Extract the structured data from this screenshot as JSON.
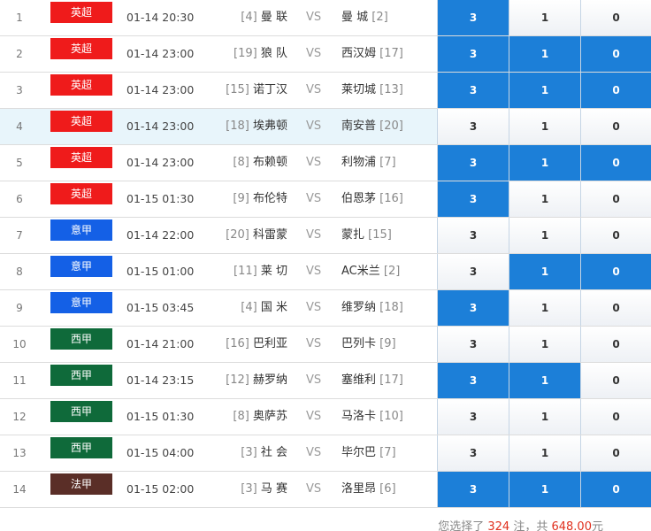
{
  "colors": {
    "league_epl": "#ef1b1b",
    "league_seriea": "#1460e6",
    "league_laliga": "#0f6a3a",
    "league_ligue1": "#5a2e27",
    "selected_odds": "#1c7fd8"
  },
  "vs_label": "VS",
  "rows": [
    {
      "idx": "1",
      "league": "英超",
      "league_color": "#ef1b1b",
      "time": "01-14 20:30",
      "home_rank": "[4]",
      "home": "曼 联",
      "away": "曼 城",
      "away_rank": "[2]",
      "odds": [
        "3",
        "1",
        "0"
      ],
      "selected": [
        true,
        false,
        false
      ],
      "highlight": false
    },
    {
      "idx": "2",
      "league": "英超",
      "league_color": "#ef1b1b",
      "time": "01-14 23:00",
      "home_rank": "[19]",
      "home": "狼 队",
      "away": "西汉姆",
      "away_rank": "[17]",
      "odds": [
        "3",
        "1",
        "0"
      ],
      "selected": [
        true,
        true,
        true
      ],
      "highlight": false
    },
    {
      "idx": "3",
      "league": "英超",
      "league_color": "#ef1b1b",
      "time": "01-14 23:00",
      "home_rank": "[15]",
      "home": "诺丁汉",
      "away": "莱切城",
      "away_rank": "[13]",
      "odds": [
        "3",
        "1",
        "0"
      ],
      "selected": [
        true,
        true,
        true
      ],
      "highlight": false
    },
    {
      "idx": "4",
      "league": "英超",
      "league_color": "#ef1b1b",
      "time": "01-14 23:00",
      "home_rank": "[18]",
      "home": "埃弗顿",
      "away": "南安普",
      "away_rank": "[20]",
      "odds": [
        "3",
        "1",
        "0"
      ],
      "selected": [
        false,
        false,
        false
      ],
      "highlight": true
    },
    {
      "idx": "5",
      "league": "英超",
      "league_color": "#ef1b1b",
      "time": "01-14 23:00",
      "home_rank": "[8]",
      "home": "布赖顿",
      "away": "利物浦",
      "away_rank": "[7]",
      "odds": [
        "3",
        "1",
        "0"
      ],
      "selected": [
        true,
        true,
        true
      ],
      "highlight": false
    },
    {
      "idx": "6",
      "league": "英超",
      "league_color": "#ef1b1b",
      "time": "01-15 01:30",
      "home_rank": "[9]",
      "home": "布伦特",
      "away": "伯恩茅",
      "away_rank": "[16]",
      "odds": [
        "3",
        "1",
        "0"
      ],
      "selected": [
        true,
        false,
        false
      ],
      "highlight": false
    },
    {
      "idx": "7",
      "league": "意甲",
      "league_color": "#1460e6",
      "time": "01-14 22:00",
      "home_rank": "[20]",
      "home": "科雷蒙",
      "away": "蒙扎",
      "away_rank": "[15]",
      "odds": [
        "3",
        "1",
        "0"
      ],
      "selected": [
        false,
        false,
        false
      ],
      "highlight": false
    },
    {
      "idx": "8",
      "league": "意甲",
      "league_color": "#1460e6",
      "time": "01-15 01:00",
      "home_rank": "[11]",
      "home": "莱 切",
      "away": "AC米兰",
      "away_rank": "[2]",
      "odds": [
        "3",
        "1",
        "0"
      ],
      "selected": [
        false,
        true,
        true
      ],
      "highlight": false
    },
    {
      "idx": "9",
      "league": "意甲",
      "league_color": "#1460e6",
      "time": "01-15 03:45",
      "home_rank": "[4]",
      "home": "国 米",
      "away": "维罗纳",
      "away_rank": "[18]",
      "odds": [
        "3",
        "1",
        "0"
      ],
      "selected": [
        true,
        false,
        false
      ],
      "highlight": false
    },
    {
      "idx": "10",
      "league": "西甲",
      "league_color": "#0f6a3a",
      "time": "01-14 21:00",
      "home_rank": "[16]",
      "home": "巴利亚",
      "away": "巴列卡",
      "away_rank": "[9]",
      "odds": [
        "3",
        "1",
        "0"
      ],
      "selected": [
        false,
        false,
        false
      ],
      "highlight": false
    },
    {
      "idx": "11",
      "league": "西甲",
      "league_color": "#0f6a3a",
      "time": "01-14 23:15",
      "home_rank": "[12]",
      "home": "赫罗纳",
      "away": "塞维利",
      "away_rank": "[17]",
      "odds": [
        "3",
        "1",
        "0"
      ],
      "selected": [
        true,
        true,
        false
      ],
      "highlight": false
    },
    {
      "idx": "12",
      "league": "西甲",
      "league_color": "#0f6a3a",
      "time": "01-15 01:30",
      "home_rank": "[8]",
      "home": "奥萨苏",
      "away": "马洛卡",
      "away_rank": "[10]",
      "odds": [
        "3",
        "1",
        "0"
      ],
      "selected": [
        false,
        false,
        false
      ],
      "highlight": false
    },
    {
      "idx": "13",
      "league": "西甲",
      "league_color": "#0f6a3a",
      "time": "01-15 04:00",
      "home_rank": "[3]",
      "home": "社 会",
      "away": "毕尔巴",
      "away_rank": "[7]",
      "odds": [
        "3",
        "1",
        "0"
      ],
      "selected": [
        false,
        false,
        false
      ],
      "highlight": false
    },
    {
      "idx": "14",
      "league": "法甲",
      "league_color": "#5a2e27",
      "time": "01-15 02:00",
      "home_rank": "[3]",
      "home": "马 赛",
      "away": "洛里昂",
      "away_rank": "[6]",
      "odds": [
        "3",
        "1",
        "0"
      ],
      "selected": [
        true,
        true,
        true
      ],
      "highlight": false
    }
  ],
  "summary": {
    "prefix": "您选择了",
    "count": "324",
    "mid": "注，共",
    "amount": "648.00",
    "suffix": "元"
  }
}
